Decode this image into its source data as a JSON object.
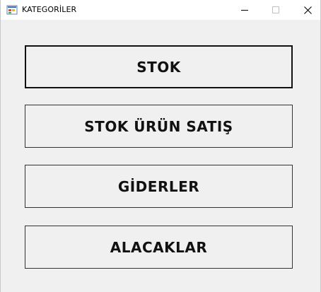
{
  "window": {
    "title": "KATEGORİLER",
    "icons": {
      "app": "windows-forms-app-icon",
      "minimize": "minimize-icon",
      "maximize": "maximize-icon",
      "close": "close-icon"
    }
  },
  "buttons": {
    "stok": "STOK",
    "stok_urun_satis": "STOK ÜRÜN SATIŞ",
    "giderler": "GİDERLER",
    "alacaklar": "ALACAKLAR"
  }
}
